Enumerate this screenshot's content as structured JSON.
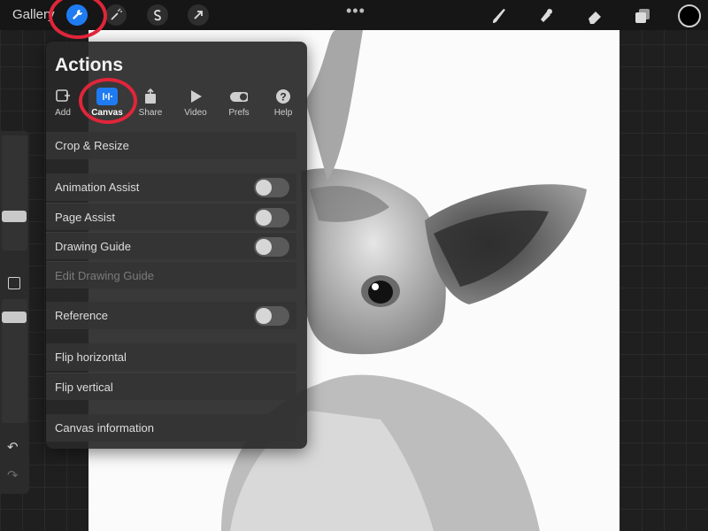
{
  "topbar": {
    "gallery_label": "Gallery",
    "more_glyph": "•••",
    "tools": [
      "wrench-icon",
      "adjustments-magic-wand-icon",
      "selection-s-icon",
      "transform-arrow-icon"
    ],
    "right_tools": [
      "brush-icon",
      "smudge-icon",
      "eraser-icon",
      "layers-icon"
    ],
    "color_current": "#000000"
  },
  "actions_panel": {
    "title": "Actions",
    "tabs": [
      {
        "label": "Add",
        "icon": "add-icon"
      },
      {
        "label": "Canvas",
        "icon": "canvas-icon",
        "active": true
      },
      {
        "label": "Share",
        "icon": "share-icon"
      },
      {
        "label": "Video",
        "icon": "video-icon"
      },
      {
        "label": "Prefs",
        "icon": "prefs-toggle-icon"
      },
      {
        "label": "Help",
        "icon": "help-icon"
      }
    ],
    "items": [
      {
        "label": "Crop & Resize"
      },
      {
        "label": "Animation Assist",
        "toggle": false
      },
      {
        "label": "Page Assist",
        "toggle": false
      },
      {
        "label": "Drawing Guide",
        "toggle": false
      },
      {
        "label": "Edit Drawing Guide",
        "disabled": true
      },
      {
        "label": "Reference",
        "toggle": false
      },
      {
        "label": "Flip horizontal"
      },
      {
        "label": "Flip vertical"
      },
      {
        "label": "Canvas information"
      }
    ]
  },
  "colors": {
    "accent": "#1f7bf2",
    "annotation_red": "#e0253a"
  }
}
